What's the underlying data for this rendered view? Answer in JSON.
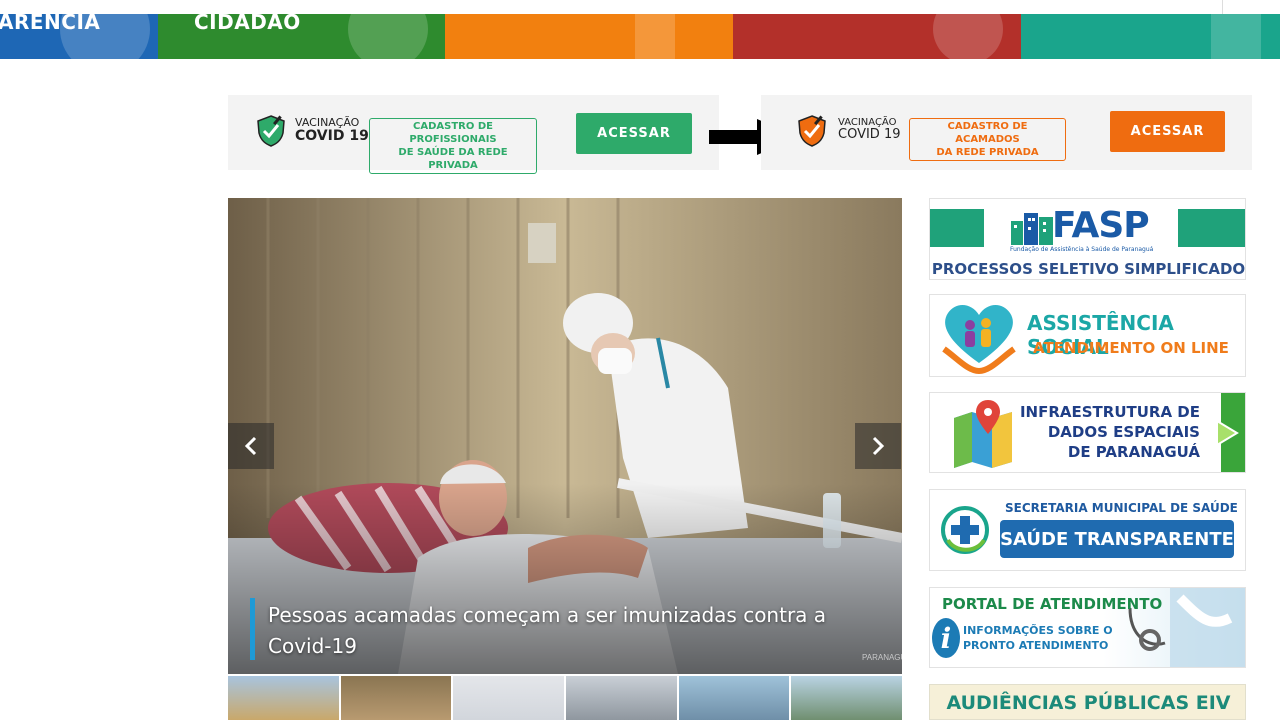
{
  "nav": {
    "items": [
      {
        "label": "ARÊNCIA",
        "color": "#1e67b5"
      },
      {
        "label": "CIDADÃO",
        "color": "#2e8b2e"
      },
      {
        "label": "",
        "color": "#f2800f"
      },
      {
        "label": "",
        "color": "#b3302a"
      },
      {
        "label": "",
        "color": "#1aa58c"
      }
    ]
  },
  "vaccine_banners": [
    {
      "title_line1": "VACINAÇÃO",
      "title_line2": "COVID 19",
      "tag": "CADASTRO DE PROFISSIONAIS DE SAÚDE DA REDE PRIVADA",
      "tag_line1": "CADASTRO DE PROFISSIONAIS",
      "tag_line2": "DE SAÚDE DA REDE PRIVADA",
      "button": "ACESSAR",
      "color": "#2eaa6a"
    },
    {
      "title_line1": "VACINAÇÃO",
      "title_line2": "COVID 19",
      "tag_line1": "CADASTRO DE ACAMADOS",
      "tag_line2": "DA REDE PRIVADA",
      "button": "ACESSAR",
      "color": "#ef6c10"
    }
  ],
  "carousel": {
    "caption": "Pessoas acamadas começam a ser imunizadas contra a Covid-19",
    "prev_icon": "chevron-left-icon",
    "next_icon": "chevron-right-icon",
    "watermark": "PARANAGUÁ"
  },
  "sidebar": {
    "fasp": {
      "logo": "FASP",
      "subtitle": "Fundação de Assistência à Saúde de Paranaguá",
      "label": "PROCESSOS SELETIVO SIMPLIFICADO"
    },
    "assistencia": {
      "title": "ASSISTÊNCIA SOCIAL",
      "subtitle": "ATENDIMENTO ON LINE"
    },
    "infraestrutura": {
      "line1": "INFRAESTRUTURA DE",
      "line2": "DADOS ESPACIAIS",
      "line3": "DE PARANAGUÁ"
    },
    "secretaria": {
      "top": "SECRETARIA MUNICIPAL DE SAÚDE",
      "button": "SAÚDE TRANSPARENTE"
    },
    "portal": {
      "title": "PORTAL DE ATENDIMENTO",
      "info_line1": "INFORMAÇÕES SOBRE O",
      "info_line2": "PRONTO ATENDIMENTO"
    },
    "audiencias": "AUDIÊNCIAS PÚBLICAS EIV"
  }
}
